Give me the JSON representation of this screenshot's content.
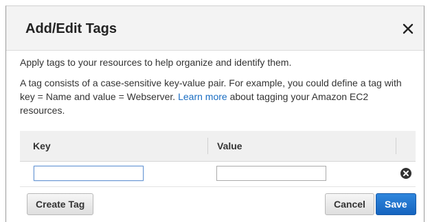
{
  "dialog": {
    "title": "Add/Edit Tags",
    "close_icon": "close-icon",
    "intro": "Apply tags to your resources to help organize and identify them.",
    "description_before_link": "A tag consists of a case-sensitive key-value pair. For example, you could define a tag with key = Name and value = Webserver. ",
    "learn_more": "Learn more",
    "description_after_link": " about tagging your Amazon EC2 resources.",
    "link_color": "#1a6dc2"
  },
  "table": {
    "columns": [
      "Key",
      "Value"
    ],
    "rows": [
      {
        "key": "",
        "value": "",
        "remove_icon": "remove-circle-icon"
      }
    ]
  },
  "buttons": {
    "create_tag": "Create Tag",
    "cancel": "Cancel",
    "save": "Save",
    "save_color": "#1a6dc2"
  }
}
